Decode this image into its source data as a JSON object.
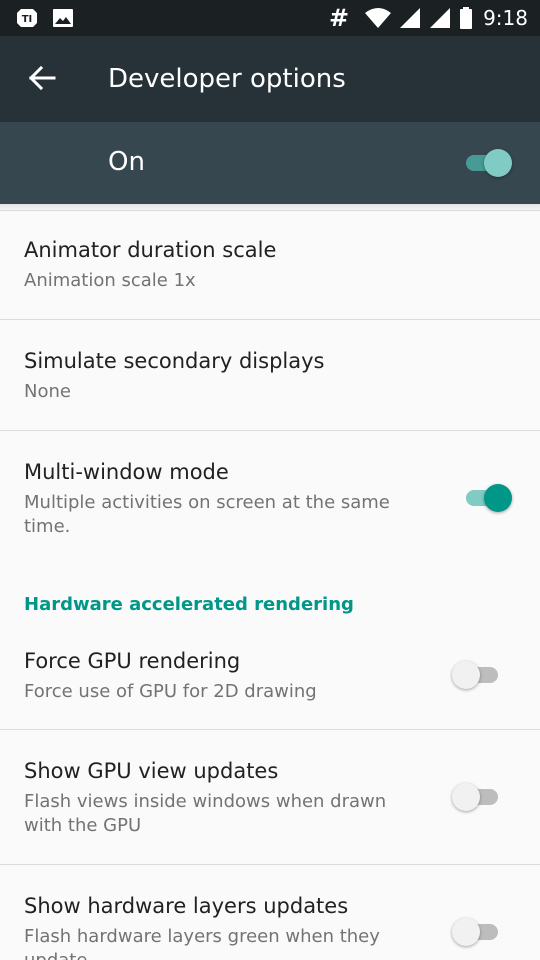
{
  "status_bar": {
    "hash": "#",
    "time": "9:18"
  },
  "app_bar": {
    "title": "Developer options"
  },
  "master": {
    "label": "On",
    "checked": true
  },
  "items": [
    {
      "title": "Animator duration scale",
      "summary": "Animation scale 1x"
    },
    {
      "title": "Simulate secondary displays",
      "summary": "None"
    },
    {
      "title": "Multi-window mode",
      "summary": "Multiple activities on screen at the same time.",
      "checked": true
    }
  ],
  "category": "Hardware accelerated rendering",
  "hw_items": [
    {
      "title": "Force GPU rendering",
      "summary": "Force use of GPU for 2D drawing",
      "checked": false
    },
    {
      "title": "Show GPU view updates",
      "summary": "Flash views inside windows when drawn with the GPU",
      "checked": false
    },
    {
      "title": "Show hardware layers updates",
      "summary": "Flash hardware layers green when they update",
      "checked": false
    }
  ],
  "colors": {
    "accent": "#009688",
    "toolbar": "#263238",
    "master_bar": "#37474f",
    "status_bar": "#1b2023"
  }
}
